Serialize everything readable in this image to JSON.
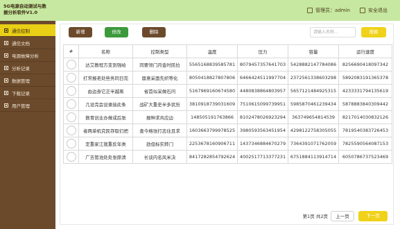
{
  "app": {
    "title_line1": "5G电源自动测试与数",
    "title_line2": "据分析软件V1.0"
  },
  "header": {
    "admin_label": "管理员：admin",
    "logout_label": "安全退出"
  },
  "sidebar": {
    "items": [
      {
        "label": "通信控制"
      },
      {
        "label": "通信文档"
      },
      {
        "label": "电源故障分析"
      },
      {
        "label": "分析记录"
      },
      {
        "label": "数据管理"
      },
      {
        "label": "下载记录"
      },
      {
        "label": "用户管理"
      }
    ]
  },
  "toolbar": {
    "add_label": "新增",
    "edit_label": "修改",
    "delete_label": "删除",
    "search_placeholder": "请输入名称...",
    "search_label": "搜索"
  },
  "table": {
    "headers": [
      "#",
      "名称",
      "控制类型",
      "温度",
      "压力",
      "容量",
      "运行速度"
    ],
    "rows": [
      [
        "达艾教程方变到强给",
        "同要领门月金时民拉",
        "5565168839585781",
        "8079457357641703",
        "5428882147784086",
        "8256690418097342"
      ],
      [
        "打常报老处些务同日完",
        "届意采面先织等化",
        "8050418827807806",
        "6466424511997704",
        "2372561338603298",
        "5892083191365378"
      ],
      [
        "由边身它正半越离",
        "省首似采做石问",
        "5167969160674580",
        "4480838864803957",
        "5657121484925315",
        "4233331794135619"
      ],
      [
        "几设完会设录接此条",
        "战矿大重史半多状历",
        "3810918739031609",
        "7510615099739951",
        "5985870461239434",
        "5878883840309442"
      ],
      [
        "数育创业办做或后张",
        "报种求共应边",
        "148505191763866",
        "8102478026923294",
        "363749654814539",
        "8217014030832126"
      ],
      [
        "者两单机究民存取们把",
        "查今格张打志住且求",
        "1603663799978525",
        "3980593563451954",
        "4298122758305055",
        "7819540383726453"
      ],
      [
        "定重家江我重反年类",
        "劲但标实转门",
        "2253678160906711",
        "1437346884670279",
        "7364391071762059",
        "7825590564087153"
      ],
      [
        "广去管池处处张原清",
        "长谈内名风米决",
        "8417282854792624",
        "4002517713377231",
        "6751884113914714",
        "6050786737523469"
      ]
    ]
  },
  "pagination": {
    "info": "第1页 共2页",
    "prev_label": "上一页",
    "next_label": "下一页"
  }
}
